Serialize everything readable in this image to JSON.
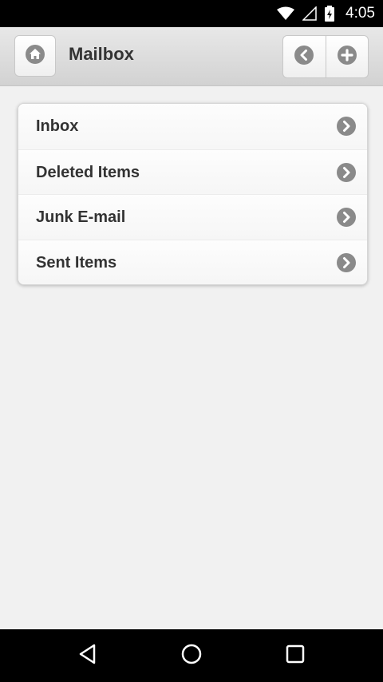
{
  "status_bar": {
    "time": "4:05"
  },
  "header": {
    "title": "Mailbox"
  },
  "list": {
    "items": [
      {
        "label": "Inbox"
      },
      {
        "label": "Deleted Items"
      },
      {
        "label": "Junk E-mail"
      },
      {
        "label": "Sent Items"
      }
    ]
  },
  "icons": {
    "home": "home-icon",
    "back": "arrow-left-icon",
    "add": "plus-icon",
    "chevron": "chevron-right-icon"
  },
  "colors": {
    "icon_gray": "#8a8a8a",
    "text": "#333333"
  }
}
